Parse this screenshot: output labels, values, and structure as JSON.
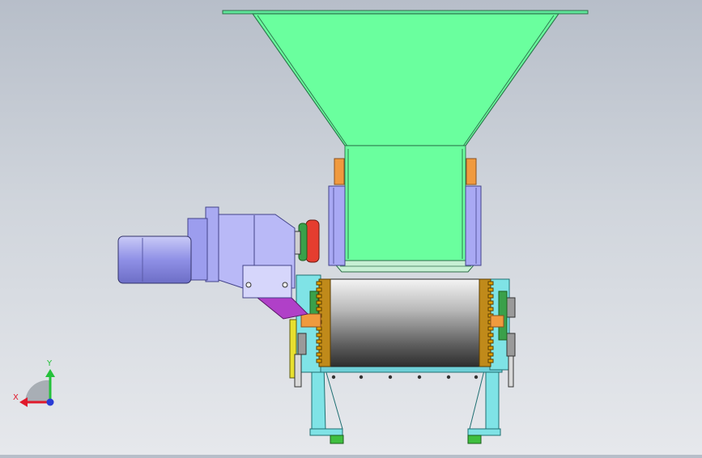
{
  "app": "CAD 3D viewport",
  "view": {
    "background_top": "#b7bec9",
    "background_bottom": "#e6e8ec"
  },
  "model": {
    "parts": [
      "hopper",
      "hopper-throat",
      "drum",
      "gear-motor",
      "gearbox",
      "drive-pulley",
      "motor-bracket",
      "frame-leg-left",
      "frame-leg-right",
      "side-plates",
      "foot-pads"
    ],
    "colors": {
      "hopper": "#6aff9e",
      "hopper_edge": "#2f7a4f",
      "motor": "#8f90e6",
      "gearbox": "#b9b9f7",
      "drum_light": "#eeeeee",
      "drum_dark": "#4a4a4a",
      "frame": "#7fe3e6",
      "bracket": "#b040c8",
      "pulley": "#e53d2f",
      "guide_blocks": "#f09a3e",
      "guide_plates": "#a9a9f4",
      "gear_teeth": "#e0a000",
      "foot_pads": "#3fbf3f"
    }
  },
  "triad": {
    "x_label": "X",
    "y_label": "Y",
    "x_color": "#e0192b",
    "y_color": "#25c13b",
    "z_color": "#2a3bd6"
  }
}
